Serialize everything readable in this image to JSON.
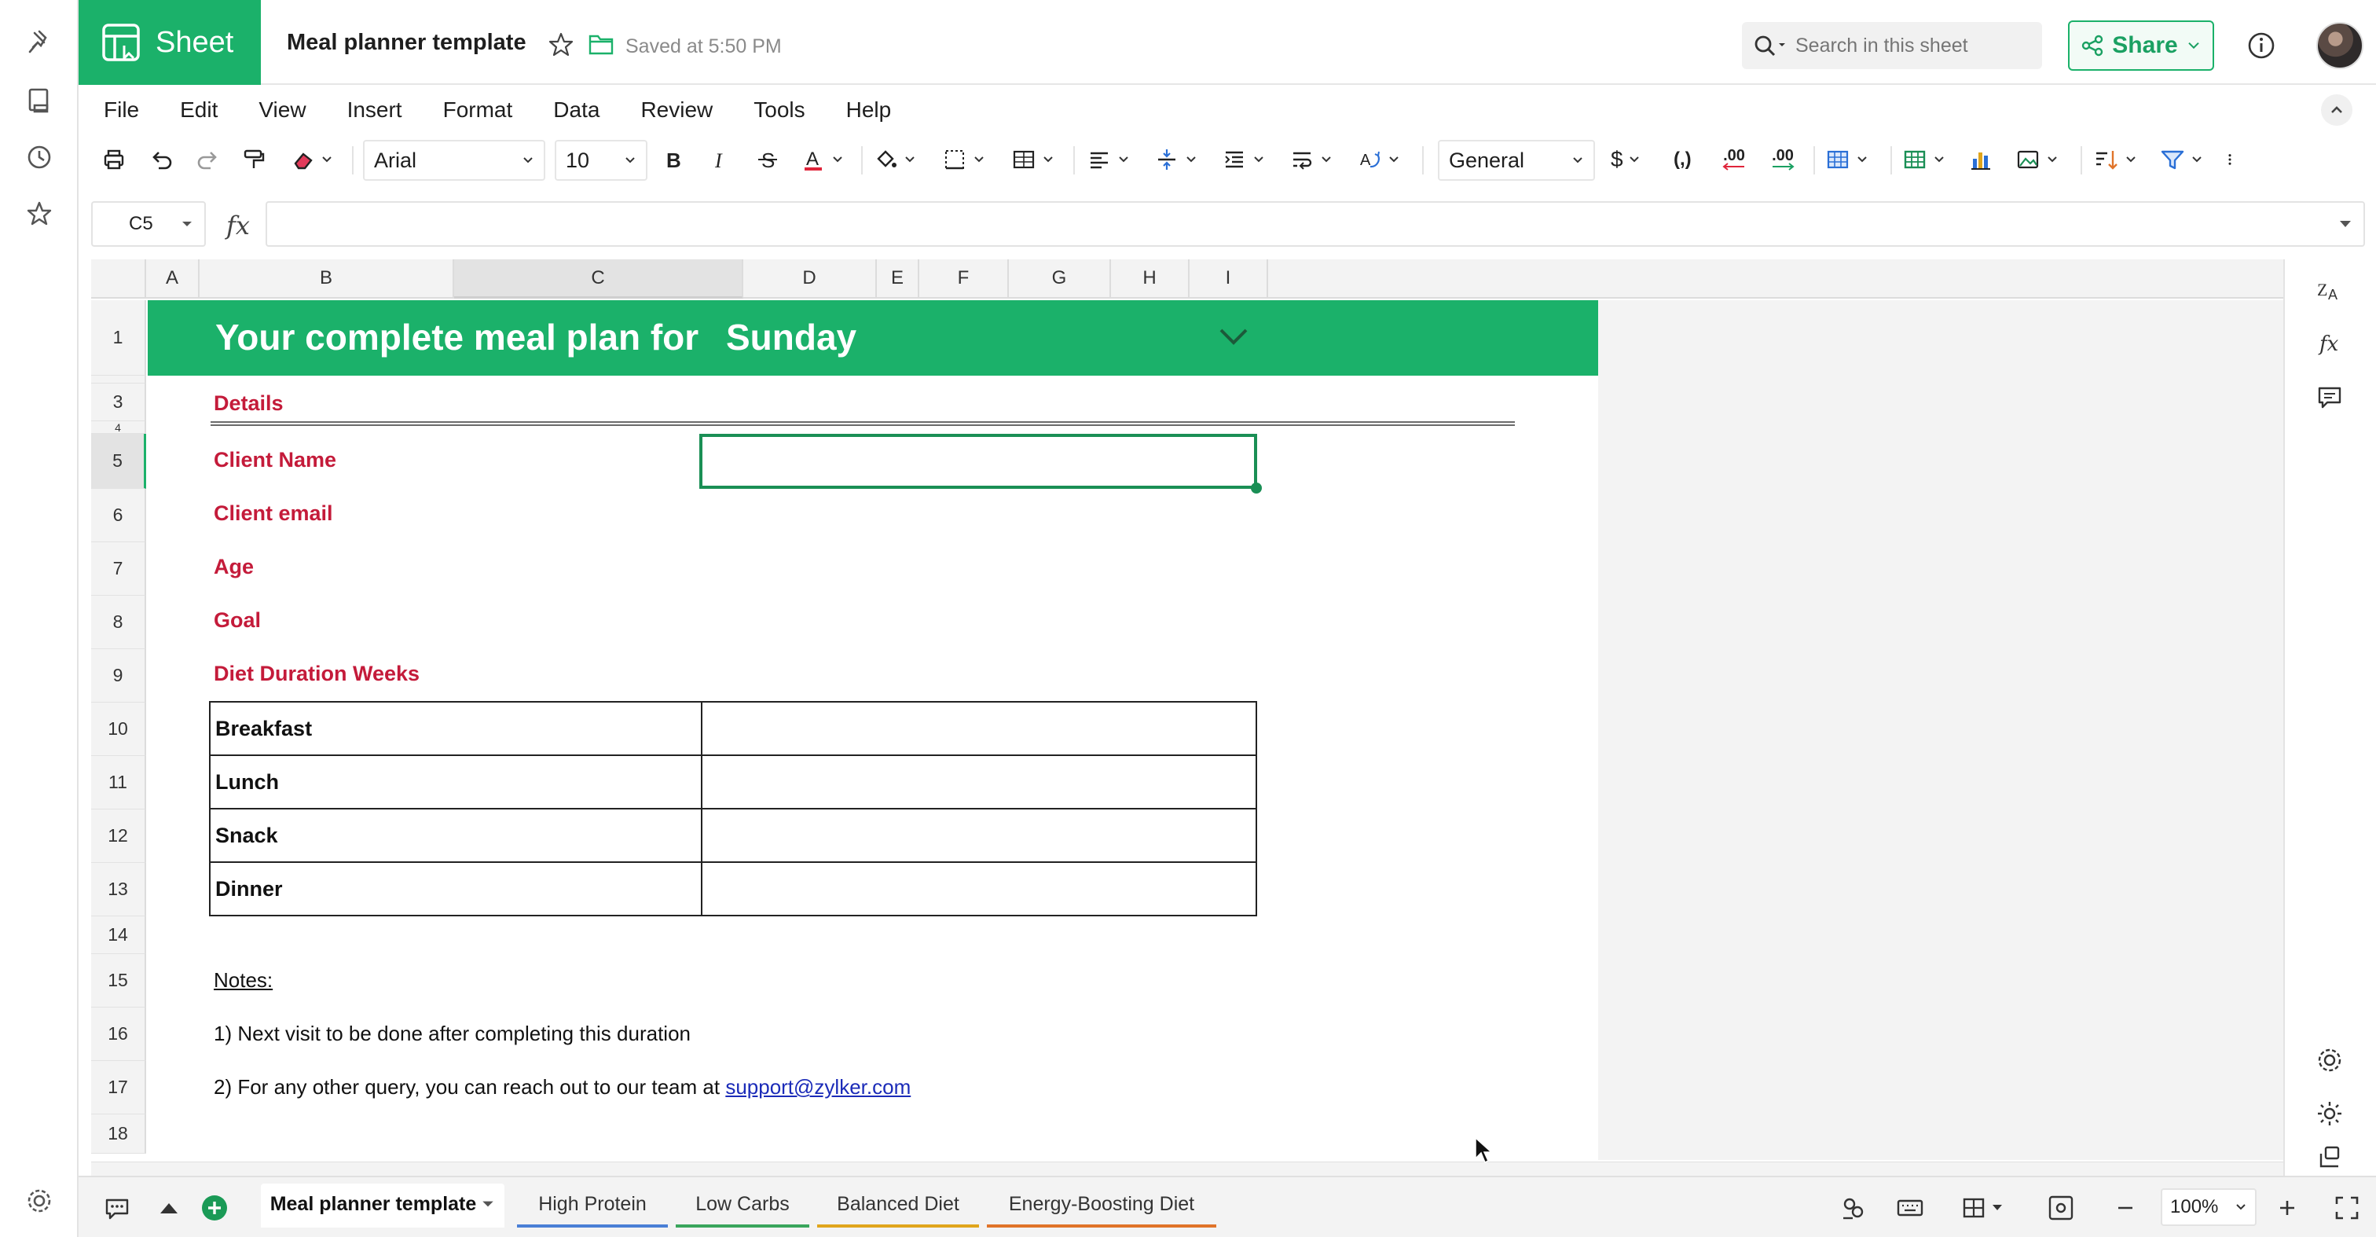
{
  "app": {
    "brand": "Sheet",
    "doc_title": "Meal planner template",
    "saved_status": "Saved at 5:50 PM",
    "search_placeholder": "Search in this sheet",
    "share_label": "Share"
  },
  "menu": [
    "File",
    "Edit",
    "View",
    "Insert",
    "Format",
    "Data",
    "Review",
    "Tools",
    "Help"
  ],
  "toolbar": {
    "font": "Arial",
    "font_size": "10",
    "number_format": "General",
    "currency_symbol": "$",
    "comma_format": "(,)",
    "decrease_decimal": ".00",
    "increase_decimal": ".00"
  },
  "formula_bar": {
    "cell_ref": "C5",
    "fx": "fx",
    "value": ""
  },
  "grid": {
    "columns": [
      "A",
      "B",
      "C",
      "D",
      "E",
      "F",
      "G",
      "H",
      "I"
    ],
    "rows": [
      "1",
      "3",
      "4",
      "5",
      "6",
      "7",
      "8",
      "9",
      "10",
      "11",
      "12",
      "13",
      "14",
      "15",
      "16",
      "17",
      "18"
    ],
    "selected_column": "C",
    "selected_row": "5"
  },
  "sheet": {
    "title_prefix": "Your complete meal plan for",
    "title_day": "Sunday",
    "details_heading": "Details",
    "fields": [
      "Client Name",
      "Client email",
      "Age",
      "Goal",
      "Diet Duration Weeks"
    ],
    "meals": [
      "Breakfast",
      "Lunch",
      "Snack",
      "Dinner"
    ],
    "notes_title": "Notes:",
    "note1": "1) Next visit to be done after completing this duration",
    "note2_prefix": "2) For any other query, you can reach out to our team at ",
    "note2_link": "support@zylker.com"
  },
  "tabs": [
    {
      "label": "Meal planner template",
      "active": true,
      "color": "#ffffff"
    },
    {
      "label": "High Protein",
      "active": false,
      "color": "#4a7fd6"
    },
    {
      "label": "Low Carbs",
      "active": false,
      "color": "#3aa55c"
    },
    {
      "label": "Balanced Diet",
      "active": false,
      "color": "#e0a51c"
    },
    {
      "label": "Energy-Boosting Diet",
      "active": false,
      "color": "#e0742a"
    }
  ],
  "zoom": "100%",
  "colors": {
    "brand_green": "#1bb16a",
    "label_red": "#c41b3a",
    "link_blue": "#1b2bb8"
  }
}
